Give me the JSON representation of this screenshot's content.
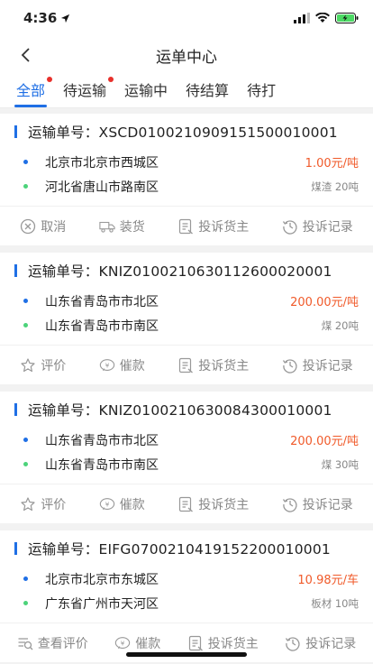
{
  "status": {
    "time": "4:36"
  },
  "header": {
    "title": "运单中心"
  },
  "tabs": [
    {
      "label": "全部",
      "active": true,
      "dot": true
    },
    {
      "label": "待运输",
      "active": false,
      "dot": true
    },
    {
      "label": "运输中",
      "active": false,
      "dot": false
    },
    {
      "label": "待结算",
      "active": false,
      "dot": false
    },
    {
      "label": "待打",
      "active": false,
      "dot": false
    }
  ],
  "orders": [
    {
      "number": "运输单号：XSCD010021090915150001000​1",
      "from": "北京市北京市西城区",
      "to": "河北省唐山市路南区",
      "price": "1.00元/吨",
      "cargo": "煤渣 20吨",
      "actions": [
        {
          "icon": "cancel-icon",
          "label": "取消"
        },
        {
          "icon": "truck-icon",
          "label": "装货"
        },
        {
          "icon": "complain-icon",
          "label": "投诉货主"
        },
        {
          "icon": "history-icon",
          "label": "投诉记录"
        }
      ]
    },
    {
      "number": "运输单号：KNIZ010021063011260002000​1",
      "from": "山东省青岛市市北区",
      "to": "山东省青岛市市南区",
      "price": "200.00元/吨",
      "cargo": "煤 20吨",
      "actions": [
        {
          "icon": "rate-icon",
          "label": "评价"
        },
        {
          "icon": "urge-icon",
          "label": "催款"
        },
        {
          "icon": "complain-icon",
          "label": "投诉货主"
        },
        {
          "icon": "history-icon",
          "label": "投诉记录"
        }
      ]
    },
    {
      "number": "运输单号：KNIZ010021063008430001000​1",
      "from": "山东省青岛市市北区",
      "to": "山东省青岛市市南区",
      "price": "200.00元/吨",
      "cargo": "煤 30吨",
      "actions": [
        {
          "icon": "rate-icon",
          "label": "评价"
        },
        {
          "icon": "urge-icon",
          "label": "催款"
        },
        {
          "icon": "complain-icon",
          "label": "投诉货主"
        },
        {
          "icon": "history-icon",
          "label": "投诉记录"
        }
      ]
    },
    {
      "number": "运输单号：EIFG070021041915220001000​1",
      "from": "北京市北京市东城区",
      "to": "广东省广州市天河区",
      "price": "10.98元/车",
      "cargo": "板材 10吨",
      "actions": [
        {
          "icon": "view-review-icon",
          "label": "查看评价"
        },
        {
          "icon": "urge-icon",
          "label": "催款"
        },
        {
          "icon": "complain-icon",
          "label": "投诉货主"
        },
        {
          "icon": "history-icon",
          "label": "投诉记录"
        }
      ]
    }
  ],
  "colors": {
    "accent": "#1f6fe5",
    "price": "#f05a2a",
    "dest": "#4cd37a",
    "badge": "#e8302b"
  }
}
